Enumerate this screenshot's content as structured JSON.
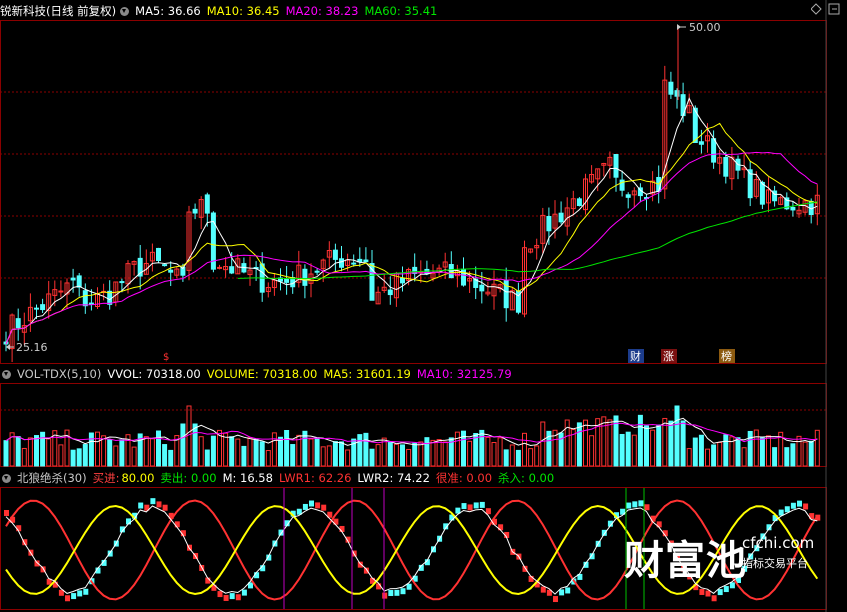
{
  "main_header": {
    "title": "锐新科技(日线 前复权)",
    "ma5": "MA5: 36.66",
    "ma10": "MA10: 36.45",
    "ma20": "MA20: 38.23",
    "ma60": "MA60: 35.41"
  },
  "main_chart": {
    "high_label": "50.00",
    "low_label": "25.16",
    "marker_s": "$",
    "event_cai": "财",
    "event_zhang": "涨",
    "event_bang": "榜"
  },
  "vol_header": {
    "name": "VOL-TDX(5,10)",
    "vvol": "VVOL: 70318.00",
    "volume": "VOLUME: 70318.00",
    "ma5": "MA5: 31601.19",
    "ma10": "MA10: 32125.79"
  },
  "ind_header": {
    "name": "北狼绝杀(30)",
    "buy_label": "买进:",
    "buy_value": "80.00",
    "sell": "卖出: 0.00",
    "m": "M: 16.58",
    "lwr1": "LWR1: 62.26",
    "lwr2": "LWR2: 74.22",
    "hen_zhun": "很准: 0.00",
    "sha_ru": "杀入: 0.00"
  },
  "watermark": {
    "brand": "财富池",
    "site": "cfchi.com",
    "slogan": "指标交易平台"
  },
  "icons": [
    "dropdown-circle-icon",
    "diamond-icon",
    "collapse-icon"
  ],
  "colors": {
    "background": "#000000",
    "up": "#ff3232",
    "down": "#54ffff",
    "ma5": "#ffffff",
    "ma10": "#ffff00",
    "ma20": "#ff00ff",
    "ma60": "#00e600",
    "grid": "#8b0000"
  }
}
